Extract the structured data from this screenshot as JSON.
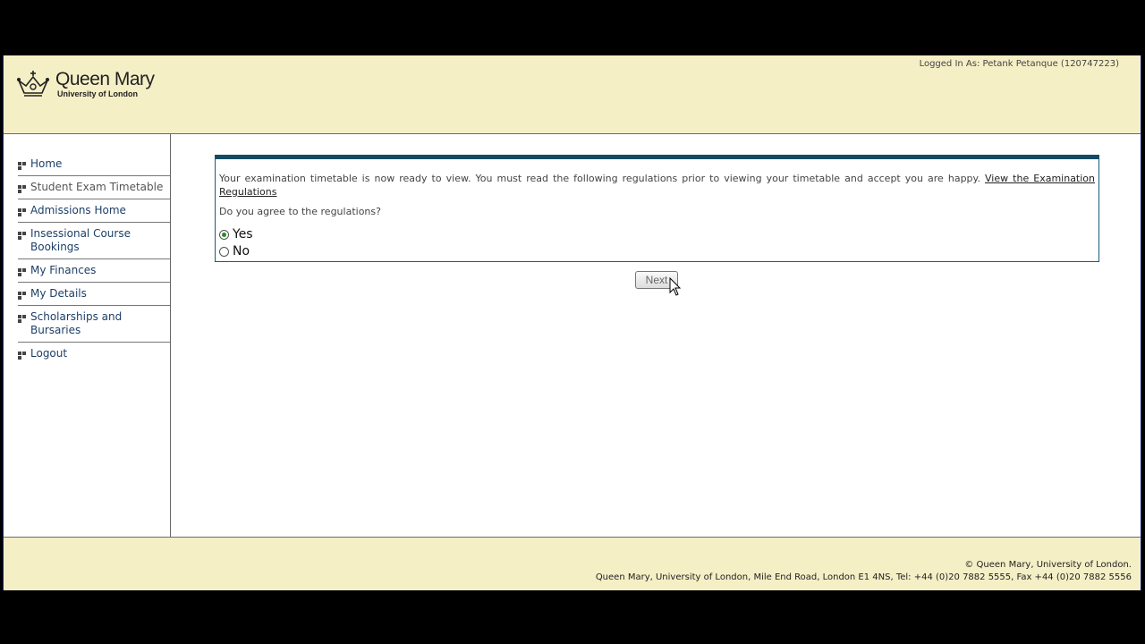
{
  "header": {
    "logo_name": "Queen Mary",
    "logo_sub": "University of London",
    "logged_in": "Logged In As: Petank Petanque (120747223)"
  },
  "sidebar": {
    "items": [
      {
        "label": "Home"
      },
      {
        "label": "Student Exam Timetable"
      },
      {
        "label": "Admissions Home"
      },
      {
        "label": "Insessional Course Bookings"
      },
      {
        "label": "My Finances"
      },
      {
        "label": "My Details"
      },
      {
        "label": "Scholarships and Bursaries"
      },
      {
        "label": "Logout"
      }
    ]
  },
  "main": {
    "intro": "Your examination timetable is now ready to view. You must read the following regulations prior to viewing your timetable and accept you are happy.",
    "regulations_link": "View the Examination Regulations",
    "question": "Do you agree to the regulations?",
    "options": [
      {
        "label": "Yes",
        "selected": true
      },
      {
        "label": "No",
        "selected": false
      }
    ],
    "next_label": "Next"
  },
  "footer": {
    "copyright": "© Queen Mary, University of London.",
    "address": "Queen Mary, University of London, Mile End Road, London E1 4NS, Tel: +44 (0)20 7882 5555, Fax +44 (0)20 7882 5556"
  }
}
